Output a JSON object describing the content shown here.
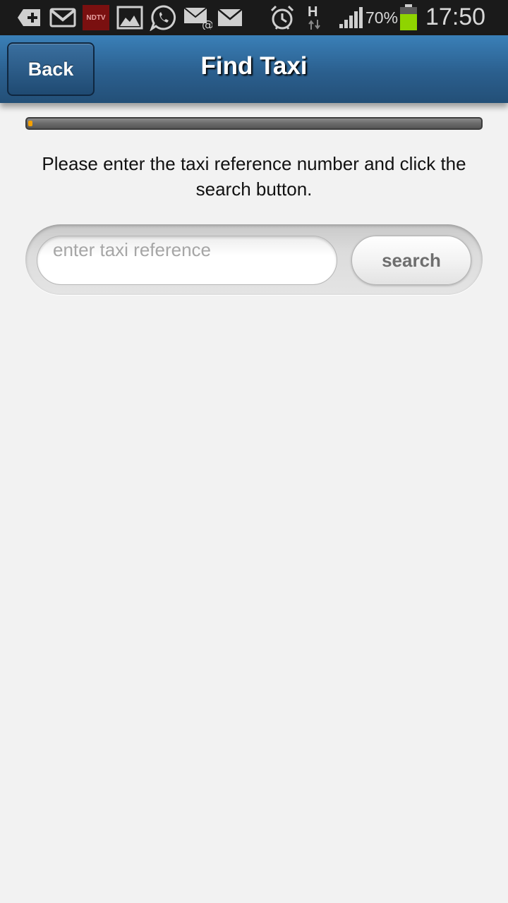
{
  "status_bar": {
    "notification_icons": [
      "add-icon",
      "gmail-icon",
      "ndtv-icon",
      "gallery-icon",
      "whatsapp-icon",
      "email-icon",
      "mail-icon"
    ],
    "ndtv_label": "NDTV",
    "alarm_icon": "alarm-icon",
    "network_type": "H",
    "signal_icon": "signal-icon",
    "battery_percent": "70%",
    "battery_level": 0.7,
    "battery_color": "#8fd400",
    "time": "17:50"
  },
  "header": {
    "back_label": "Back",
    "title": "Find Taxi",
    "bar_color": "#2b5f8e"
  },
  "progress": {
    "fraction": 0.01,
    "fill_color": "#f5a000"
  },
  "main": {
    "instructions": "Please enter the taxi reference number and click the search button.",
    "search": {
      "placeholder": "enter taxi reference",
      "value": "",
      "button_label": "search"
    }
  }
}
